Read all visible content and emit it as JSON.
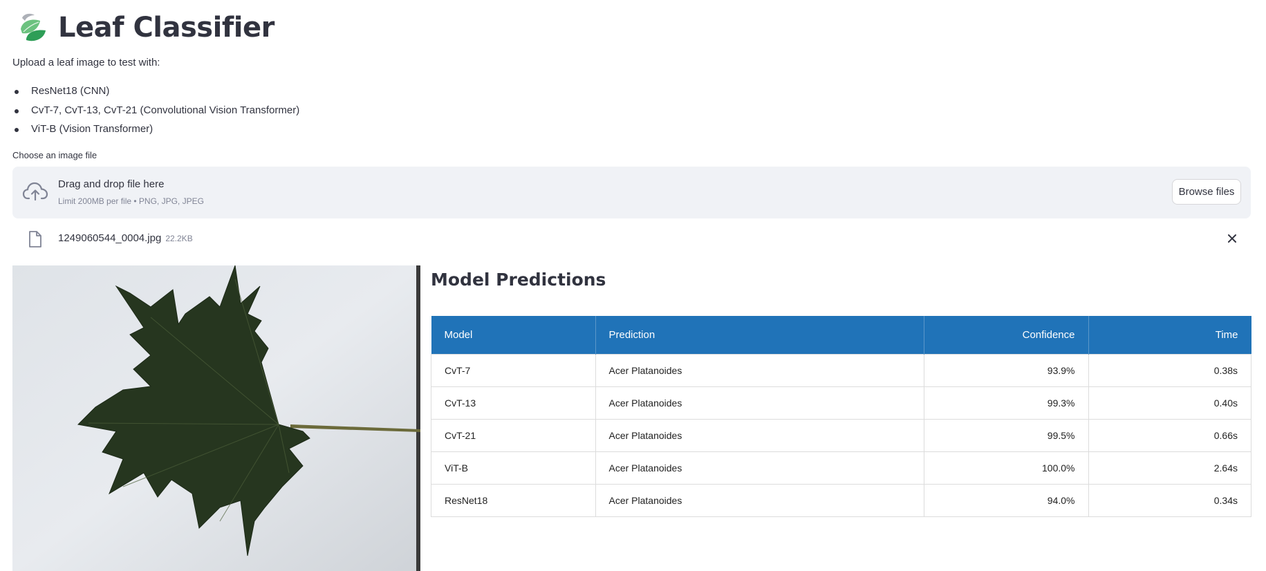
{
  "app": {
    "title": "Leaf Classifier",
    "intro": "Upload a leaf image to test with:",
    "model_list": [
      "ResNet18 (CNN)",
      "CvT-7, CvT-13, CvT-21 (Convolutional Vision Transformer)",
      "ViT-B (Vision Transformer)"
    ]
  },
  "uploader": {
    "label": "Choose an image file",
    "drop_text": "Drag and drop file here",
    "limit_text": "Limit 200MB per file • PNG, JPG, JPEG",
    "browse_label": "Browse files",
    "file_name": "1249060544_0004.jpg",
    "file_size": "22.2KB"
  },
  "predictions": {
    "title": "Model Predictions",
    "columns": [
      "Model",
      "Prediction",
      "Confidence",
      "Time"
    ],
    "rows": [
      {
        "model": "CvT-7",
        "prediction": "Acer Platanoides",
        "confidence": "93.9%",
        "time": "0.38s"
      },
      {
        "model": "CvT-13",
        "prediction": "Acer Platanoides",
        "confidence": "99.3%",
        "time": "0.40s"
      },
      {
        "model": "CvT-21",
        "prediction": "Acer Platanoides",
        "confidence": "99.5%",
        "time": "0.66s"
      },
      {
        "model": "ViT-B",
        "prediction": "Acer Platanoides",
        "confidence": "100.0%",
        "time": "2.64s"
      },
      {
        "model": "ResNet18",
        "prediction": "Acer Platanoides",
        "confidence": "94.0%",
        "time": "0.34s"
      }
    ]
  },
  "colors": {
    "header_bg": "#2073b8",
    "confidence_text": "#2ebf5e",
    "model_link": "#2a6fb0",
    "dropzone_bg": "#f0f2f6"
  },
  "icons": {
    "logo": "leaf-logo-icon",
    "upload": "cloud-upload-icon",
    "file": "file-icon",
    "close": "close-icon"
  }
}
